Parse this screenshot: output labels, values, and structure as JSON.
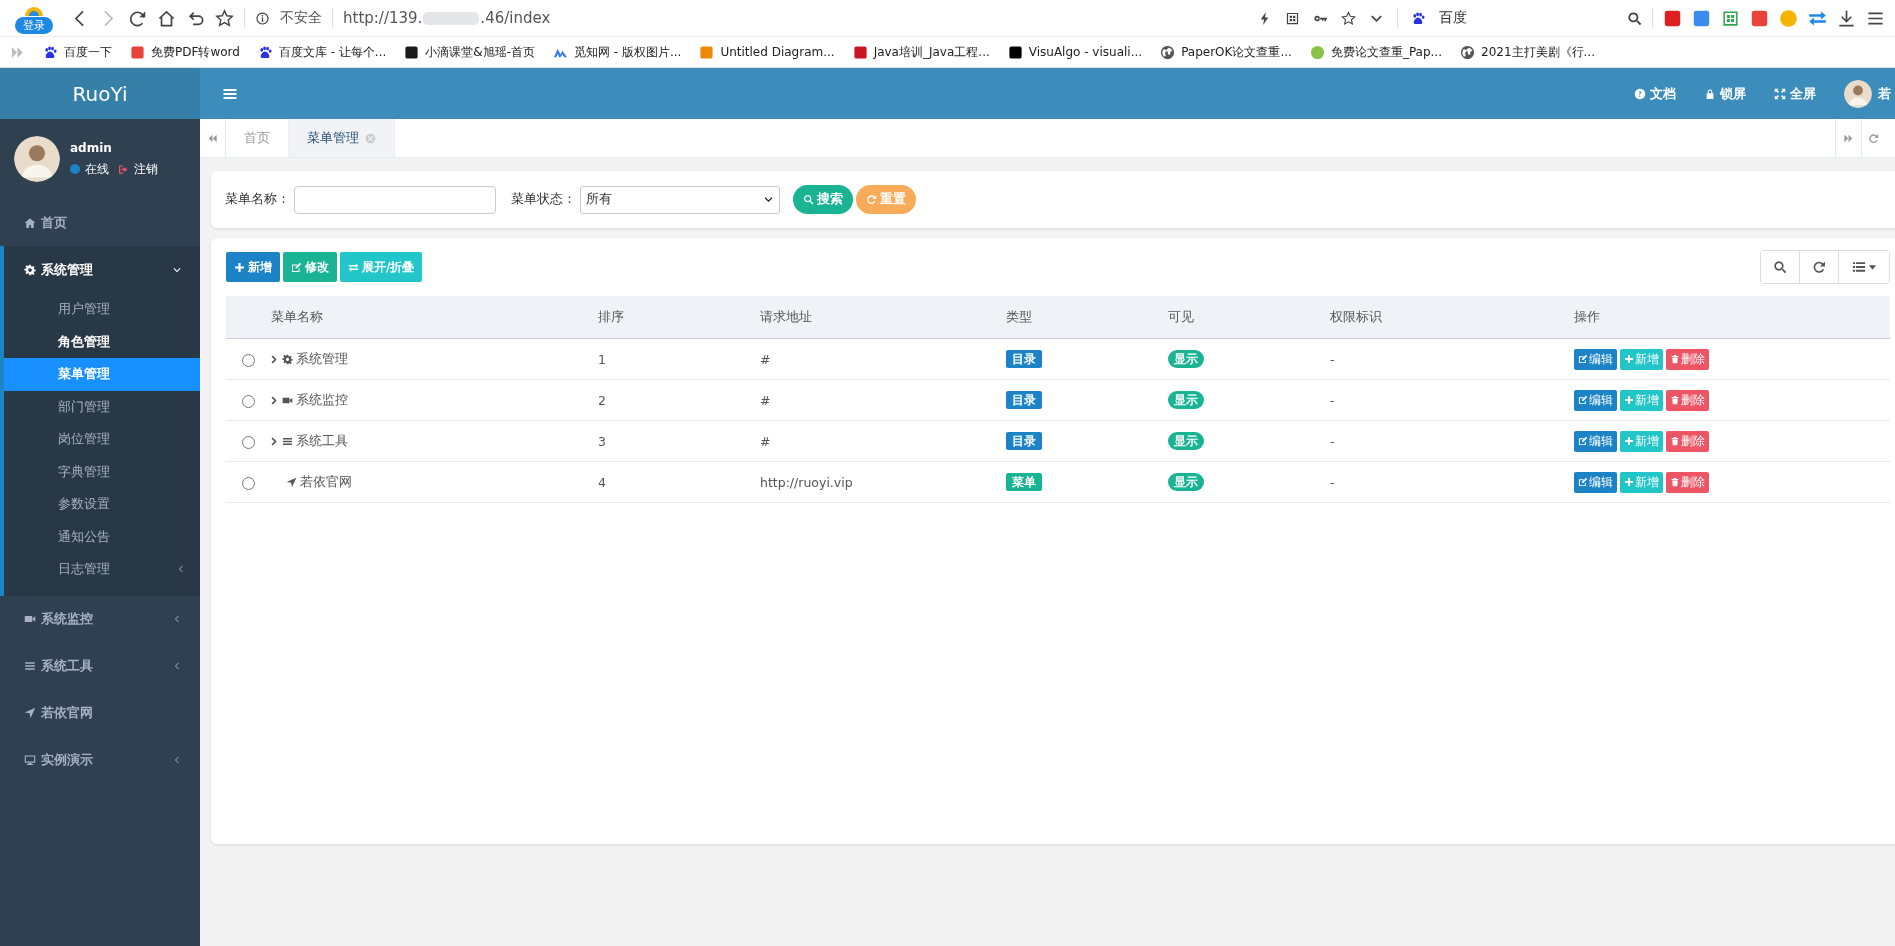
{
  "browser": {
    "profile_label": "登录",
    "security": "不安全",
    "url_head": "http://139.",
    "url_tail": ".46/index",
    "search_engine": "百度",
    "bookmarks": [
      {
        "label": "百度一下",
        "color": "#2932e1",
        "kind": "paw"
      },
      {
        "label": "免费PDF转word",
        "color": "#e9443b",
        "kind": "square"
      },
      {
        "label": "百度文库 - 让每个...",
        "color": "#2932e1",
        "kind": "paw"
      },
      {
        "label": "小滴课堂&旭瑶-首页",
        "color": "#1a1a1a",
        "kind": "square"
      },
      {
        "label": "觅知网 - 版权图片...",
        "color": "#3a7bf0",
        "kind": "peak"
      },
      {
        "label": "Untitled Diagram...",
        "color": "#f08705",
        "kind": "square"
      },
      {
        "label": "Java培训_Java工程...",
        "color": "#c81623",
        "kind": "square"
      },
      {
        "label": "VisuAlgo - visuali...",
        "color": "#000000",
        "kind": "square"
      },
      {
        "label": "PaperOK论文查重...",
        "color": "#555555",
        "kind": "globe"
      },
      {
        "label": "免费论文查重_Pap...",
        "color": "#8bc34a",
        "kind": "circle"
      },
      {
        "label": "2021主打美剧《行...",
        "color": "#555555",
        "kind": "globe"
      }
    ]
  },
  "header": {
    "actions": [
      {
        "label": "文档"
      },
      {
        "label": "锁屏"
      },
      {
        "label": "全屏"
      }
    ],
    "user_name": "若"
  },
  "sidebar": {
    "brand": "RuoYi",
    "user": {
      "name": "admin",
      "status": "在线",
      "logout": "注销"
    },
    "menu": [
      {
        "label": "首页",
        "kind": "link",
        "expanded": false,
        "selected": false
      },
      {
        "label": "系统管理",
        "kind": "folder",
        "expanded": true,
        "selected": false,
        "children": [
          {
            "label": "用户管理",
            "kind": "link",
            "expanded": false,
            "selected": false,
            "highlighted": false
          },
          {
            "label": "角色管理",
            "kind": "link",
            "expanded": false,
            "selected": false,
            "highlighted": true
          },
          {
            "label": "菜单管理",
            "kind": "link",
            "expanded": false,
            "selected": true,
            "highlighted": false
          },
          {
            "label": "部门管理",
            "kind": "link",
            "expanded": false,
            "selected": false,
            "highlighted": false
          },
          {
            "label": "岗位管理",
            "kind": "link",
            "expanded": false,
            "selected": false,
            "highlighted": false
          },
          {
            "label": "字典管理",
            "kind": "link",
            "expanded": false,
            "selected": false,
            "highlighted": false
          },
          {
            "label": "参数设置",
            "kind": "link",
            "expanded": false,
            "selected": false,
            "highlighted": false
          },
          {
            "label": "通知公告",
            "kind": "link",
            "expanded": false,
            "selected": false,
            "highlighted": false
          },
          {
            "label": "日志管理",
            "kind": "folder",
            "expanded": false,
            "selected": false,
            "highlighted": false
          }
        ]
      },
      {
        "label": "系统监控",
        "kind": "folder",
        "expanded": false,
        "selected": false
      },
      {
        "label": "系统工具",
        "kind": "folder",
        "expanded": false,
        "selected": false
      },
      {
        "label": "若依官网",
        "kind": "link",
        "expanded": false,
        "selected": false
      },
      {
        "label": "实例演示",
        "kind": "folder",
        "expanded": false,
        "selected": false
      }
    ]
  },
  "tabs": [
    {
      "label": "首页",
      "selected": false
    },
    {
      "label": "菜单管理",
      "selected": true
    }
  ],
  "search_form": {
    "name_label": "菜单名称：",
    "status_label": "菜单状态：",
    "status_value": "所有",
    "buttons": [
      {
        "label": "搜索",
        "kind": "search"
      },
      {
        "label": "重置",
        "kind": "reset"
      }
    ]
  },
  "toolbar": [
    {
      "label": "新增",
      "kind": "add"
    },
    {
      "label": "修改",
      "kind": "edit"
    },
    {
      "label": "展开/折叠",
      "kind": "toggle"
    }
  ],
  "table": {
    "columns": [
      "菜单名称",
      "排序",
      "请求地址",
      "类型",
      "可见",
      "权限标识",
      "操作"
    ],
    "rows": [
      {
        "selected": false,
        "expandable": true,
        "name": "系统管理",
        "order": "1",
        "url": "#",
        "type": {
          "label": "目录",
          "color": "#1c84c6"
        },
        "visible": "显示",
        "perms": "-",
        "actions": [
          {
            "label": "编辑",
            "kind": "edit"
          },
          {
            "label": "新增",
            "kind": "add"
          },
          {
            "label": "删除",
            "kind": "delete"
          }
        ]
      },
      {
        "selected": false,
        "expandable": true,
        "name": "系统监控",
        "order": "2",
        "url": "#",
        "type": {
          "label": "目录",
          "color": "#1c84c6"
        },
        "visible": "显示",
        "perms": "-",
        "actions": [
          {
            "label": "编辑",
            "kind": "edit"
          },
          {
            "label": "新增",
            "kind": "add"
          },
          {
            "label": "删除",
            "kind": "delete"
          }
        ]
      },
      {
        "selected": false,
        "expandable": true,
        "name": "系统工具",
        "order": "3",
        "url": "#",
        "type": {
          "label": "目录",
          "color": "#1c84c6"
        },
        "visible": "显示",
        "perms": "-",
        "actions": [
          {
            "label": "编辑",
            "kind": "edit"
          },
          {
            "label": "新增",
            "kind": "add"
          },
          {
            "label": "删除",
            "kind": "delete"
          }
        ]
      },
      {
        "selected": false,
        "expandable": false,
        "name": "若依官网",
        "order": "4",
        "url": "http://ruoyi.vip",
        "type": {
          "label": "菜单",
          "color": "#1ab394"
        },
        "visible": "显示",
        "perms": "-",
        "actions": [
          {
            "label": "编辑",
            "kind": "edit"
          },
          {
            "label": "新增",
            "kind": "add"
          },
          {
            "label": "删除",
            "kind": "delete"
          }
        ]
      }
    ]
  }
}
